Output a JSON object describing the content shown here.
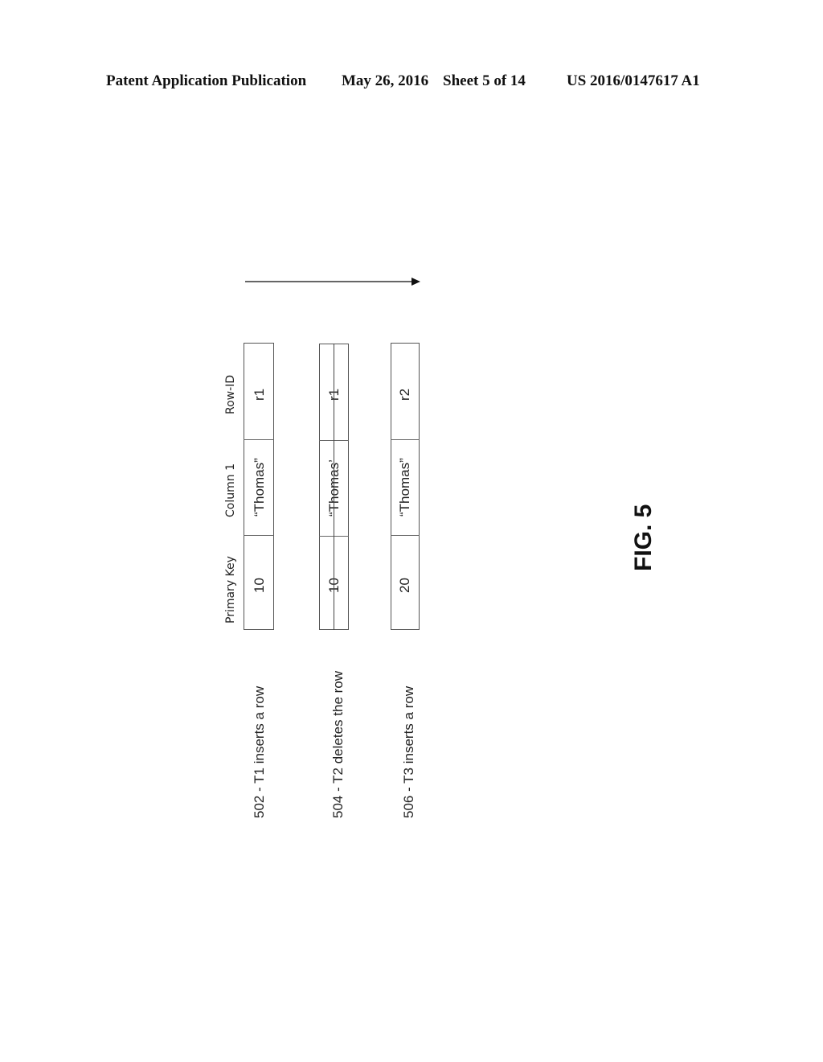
{
  "header": {
    "publication": "Patent Application Publication",
    "date": "May 26, 2016",
    "sheet": "Sheet 5 of 14",
    "number": "US 2016/0147617 A1"
  },
  "diagram": {
    "columns": [
      "Primary Key",
      "Column 1",
      "Row-ID"
    ],
    "rows": [
      {
        "label": "502 - T1 inserts a row",
        "cells": [
          "10",
          "“Thomas”",
          "r1"
        ],
        "deleted": false
      },
      {
        "label": "504 - T2 deletes the row",
        "cells": [
          "10",
          "“Thomas’",
          "r1"
        ],
        "deleted": true
      },
      {
        "label": "506 - T3 inserts a row",
        "cells": [
          "20",
          "“Thomas”",
          "r2"
        ],
        "deleted": false
      }
    ],
    "arrow": "time-arrow"
  },
  "figure_label": "FIG. 5"
}
